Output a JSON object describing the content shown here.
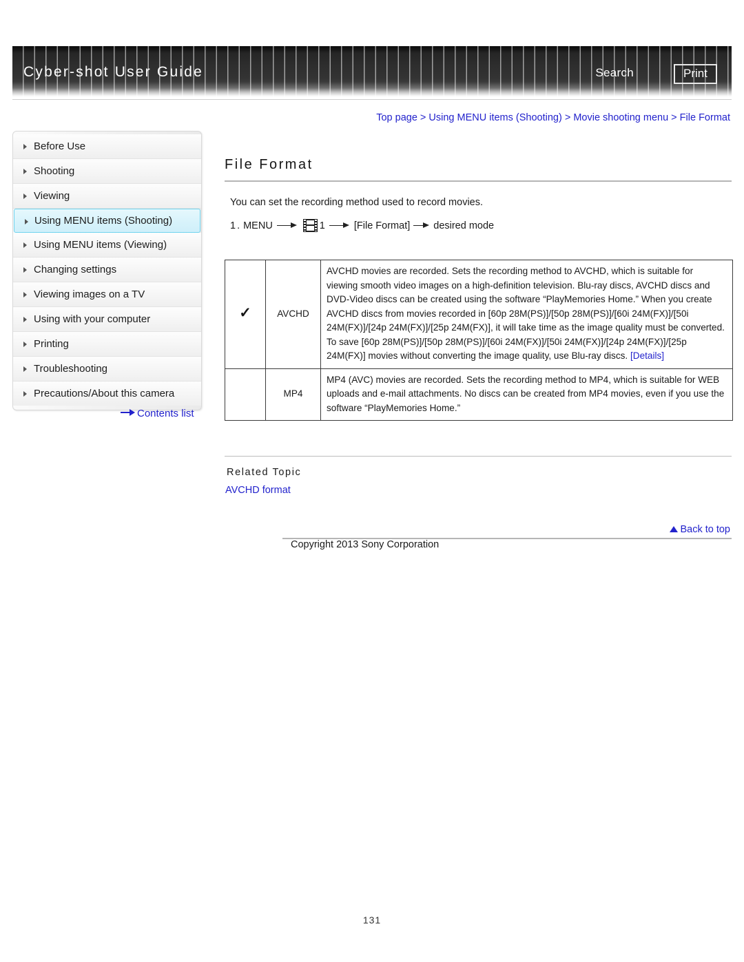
{
  "header": {
    "title": "Cyber-shot User Guide",
    "search_label": "Search",
    "print_label": "Print"
  },
  "breadcrumb": {
    "text": "Top page > Using MENU items (Shooting) > Movie shooting menu > File Format"
  },
  "sidebar": {
    "items": [
      {
        "label": "Before Use",
        "selected": false
      },
      {
        "label": "Shooting",
        "selected": false
      },
      {
        "label": "Viewing",
        "selected": false
      },
      {
        "label": "Using MENU items (Shooting)",
        "selected": true
      },
      {
        "label": "Using MENU items (Viewing)",
        "selected": false
      },
      {
        "label": "Changing settings",
        "selected": false
      },
      {
        "label": "Viewing images on a TV",
        "selected": false
      },
      {
        "label": "Using with your computer",
        "selected": false
      },
      {
        "label": "Printing",
        "selected": false
      },
      {
        "label": "Troubleshooting",
        "selected": false
      },
      {
        "label": "Precautions/About this camera",
        "selected": false
      }
    ],
    "contents_list_label": "Contents list"
  },
  "main": {
    "page_title": "File Format",
    "intro": "You can set the recording method used to record movies.",
    "step": {
      "number": "1.",
      "menu_label": "MENU",
      "movie_icon_number": "1",
      "item_label": "[File Format]",
      "result_label": "desired mode"
    },
    "table": {
      "rows": [
        {
          "checked": "✓",
          "label": "AVCHD",
          "description": "AVCHD movies are recorded. Sets the recording method to AVCHD, which is suitable for viewing smooth video images on a high-definition television. Blu-ray discs, AVCHD discs and DVD-Video discs can be created using the software “PlayMemories Home.” When you create AVCHD discs from movies recorded in [60p 28M(PS)]/[50p 28M(PS)]/[60i 24M(FX)]/[50i 24M(FX)]/[24p 24M(FX)]/[25p 24M(FX)], it will take time as the image quality must be converted. To save [60p 28M(PS)]/[50p 28M(PS)]/[60i 24M(FX)]/[50i 24M(FX)]/[24p 24M(FX)]/[25p 24M(FX)] movies without converting the image quality, use Blu-ray discs. ",
          "link": "[Details]"
        },
        {
          "checked": "",
          "label": "MP4",
          "description": "MP4 (AVC) movies are recorded. Sets the recording method to MP4, which is suitable for WEB uploads and e-mail attachments. No discs can be created from MP4 movies, even if you use the software “PlayMemories Home.”",
          "link": ""
        }
      ]
    },
    "related_topic_heading": "Related Topic",
    "related_topic_link": "AVCHD format"
  },
  "footer": {
    "back_to_top": "Back to top",
    "copyright": "Copyright 2013 Sony Corporation",
    "page_number": "131"
  },
  "colors": {
    "link": "#2222cc",
    "selected_nav": "#cfeffa",
    "header_bg": "#2e2e2e"
  }
}
